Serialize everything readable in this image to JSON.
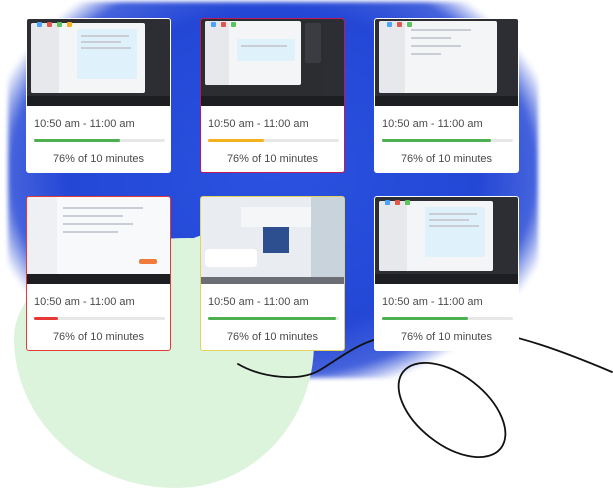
{
  "cards": [
    {
      "time": "10:50 am - 11:00 am",
      "progress_text": "76% of 10 minutes",
      "progress": 0.66,
      "border": "#ffffff",
      "bar_color": "#4caf50",
      "thumb": "chat-window"
    },
    {
      "time": "10:50 am - 11:00 am",
      "progress_text": "76% of 10 minutes",
      "progress": 0.43,
      "border": "#c2185b",
      "bar_color": "#f5b21f",
      "thumb": "chat-window-dark"
    },
    {
      "time": "10:50 am - 11:00 am",
      "progress_text": "76% of 10 minutes",
      "progress": 0.83,
      "border": "#ffffff",
      "bar_color": "#4caf50",
      "thumb": "email-window"
    },
    {
      "time": "10:50 am - 11:00 am",
      "progress_text": "76% of 10 minutes",
      "progress": 0.18,
      "border": "#e53935",
      "bar_color": "#e53935",
      "thumb": "document-editor"
    },
    {
      "time": "10:50 am - 11:00 am",
      "progress_text": "76% of 10 minutes",
      "progress": 0.98,
      "border": "#e5d25a",
      "bar_color": "#4caf50",
      "thumb": "bathroom-photo"
    },
    {
      "time": "10:50 am - 11:00 am",
      "progress_text": "76% of 10 minutes",
      "progress": 0.66,
      "border": "#ffffff",
      "bar_color": "#4caf50",
      "thumb": "chat-window"
    }
  ]
}
